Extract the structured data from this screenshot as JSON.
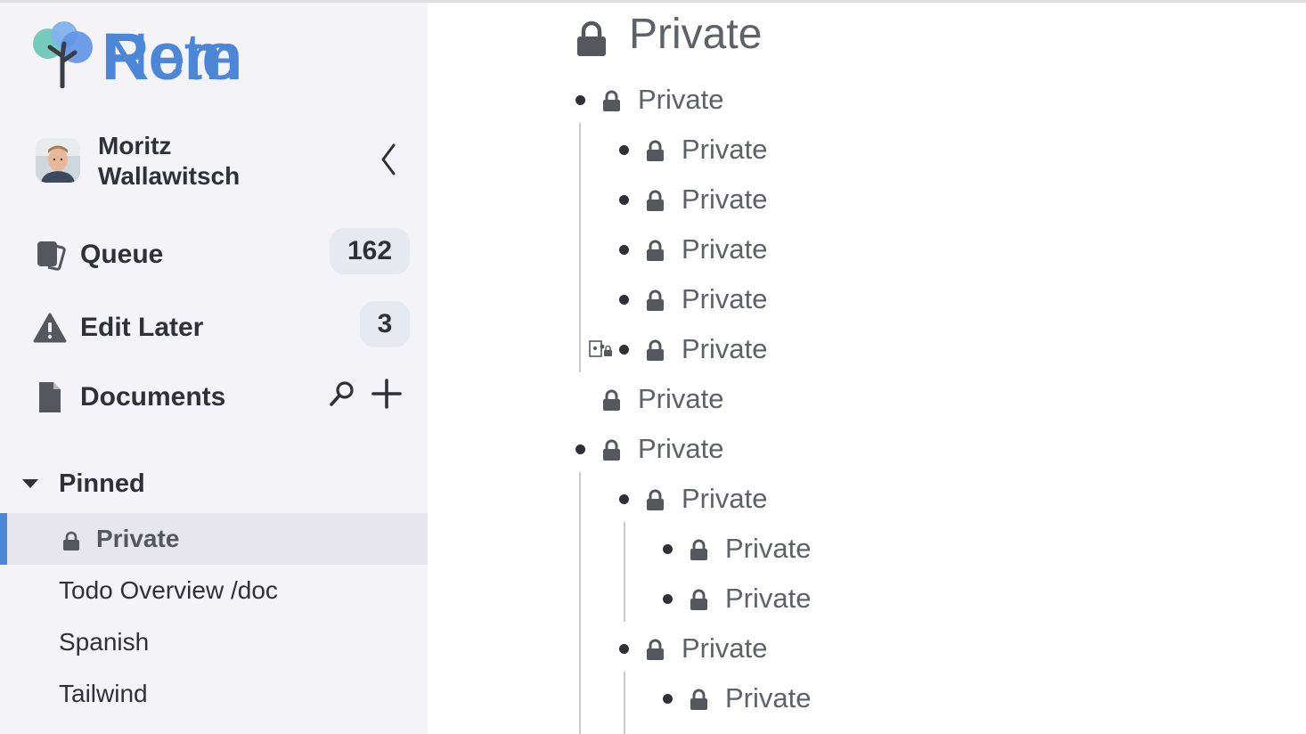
{
  "app": {
    "logo_rem": "Rem",
    "logo_note": "Note",
    "brand_color": "#4b87d6"
  },
  "user": {
    "name": "Moritz Wallawitsch",
    "avatar_icon": "user-avatar",
    "collapse_icon": "chevron-left-icon"
  },
  "nav": {
    "queue": {
      "label": "Queue",
      "count": "162",
      "icon": "flashcards-icon"
    },
    "edit_later": {
      "label": "Edit Later",
      "count": "3",
      "icon": "warning-icon"
    },
    "documents": {
      "label": "Documents",
      "icon": "document-icon",
      "search_icon": "search-icon",
      "add_icon": "plus-icon"
    }
  },
  "pinned": {
    "label": "Pinned",
    "items": [
      {
        "label": "Private",
        "locked": true,
        "active": true
      },
      {
        "label": "Todo Overview /doc",
        "locked": false
      },
      {
        "label": "Spanish",
        "locked": false
      },
      {
        "label": "Tailwind",
        "locked": false
      }
    ]
  },
  "document": {
    "title": "Private",
    "rems": [
      {
        "text": "Private",
        "level": 0,
        "bullet": true
      },
      {
        "text": "Private",
        "level": 1,
        "bullet": true
      },
      {
        "text": "Private",
        "level": 1,
        "bullet": true
      },
      {
        "text": "Private",
        "level": 1,
        "bullet": true
      },
      {
        "text": "Private",
        "level": 1,
        "bullet": true
      },
      {
        "text": "Private",
        "level": 1,
        "bullet": true,
        "drag_handle": true
      },
      {
        "text": "Private",
        "level": 0,
        "bullet": false
      },
      {
        "text": "Private",
        "level": 0,
        "bullet": true
      },
      {
        "text": "Private",
        "level": 1,
        "bullet": true
      },
      {
        "text": "Private",
        "level": 2,
        "bullet": true
      },
      {
        "text": "Private",
        "level": 2,
        "bullet": true
      },
      {
        "text": "Private",
        "level": 1,
        "bullet": true
      },
      {
        "text": "Private",
        "level": 2,
        "bullet": true
      }
    ]
  }
}
